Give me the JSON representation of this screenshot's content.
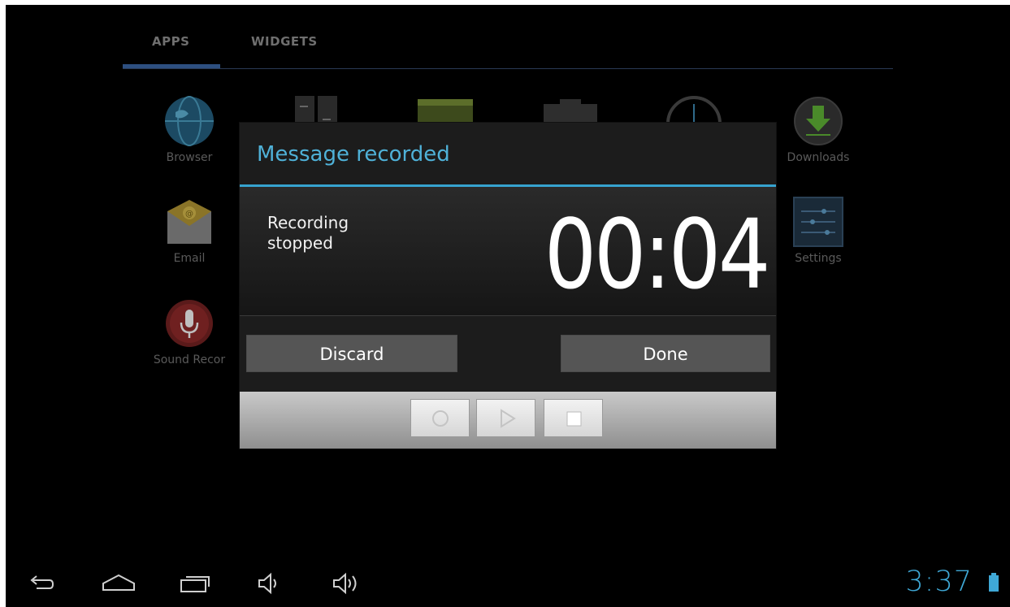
{
  "tabs": {
    "apps": "APPS",
    "widgets": "WIDGETS"
  },
  "apps": {
    "browser": "Browser",
    "email": "Email",
    "sound_recorder": "Sound Recor",
    "downloads": "Downloads",
    "settings": "Settings"
  },
  "dialog": {
    "title": "Message recorded",
    "status": "Recording stopped",
    "timer": "00:04",
    "discard_label": "Discard",
    "done_label": "Done"
  },
  "controls": {
    "record_icon": "record-icon",
    "play_icon": "play-icon",
    "stop_icon": "stop-icon"
  },
  "status_bar": {
    "time": "3:37"
  },
  "colors": {
    "accent": "#36a3cf",
    "clock": "#3fa8d6",
    "dialog_bg": "#1c1c1c",
    "button_bg": "#555555"
  }
}
